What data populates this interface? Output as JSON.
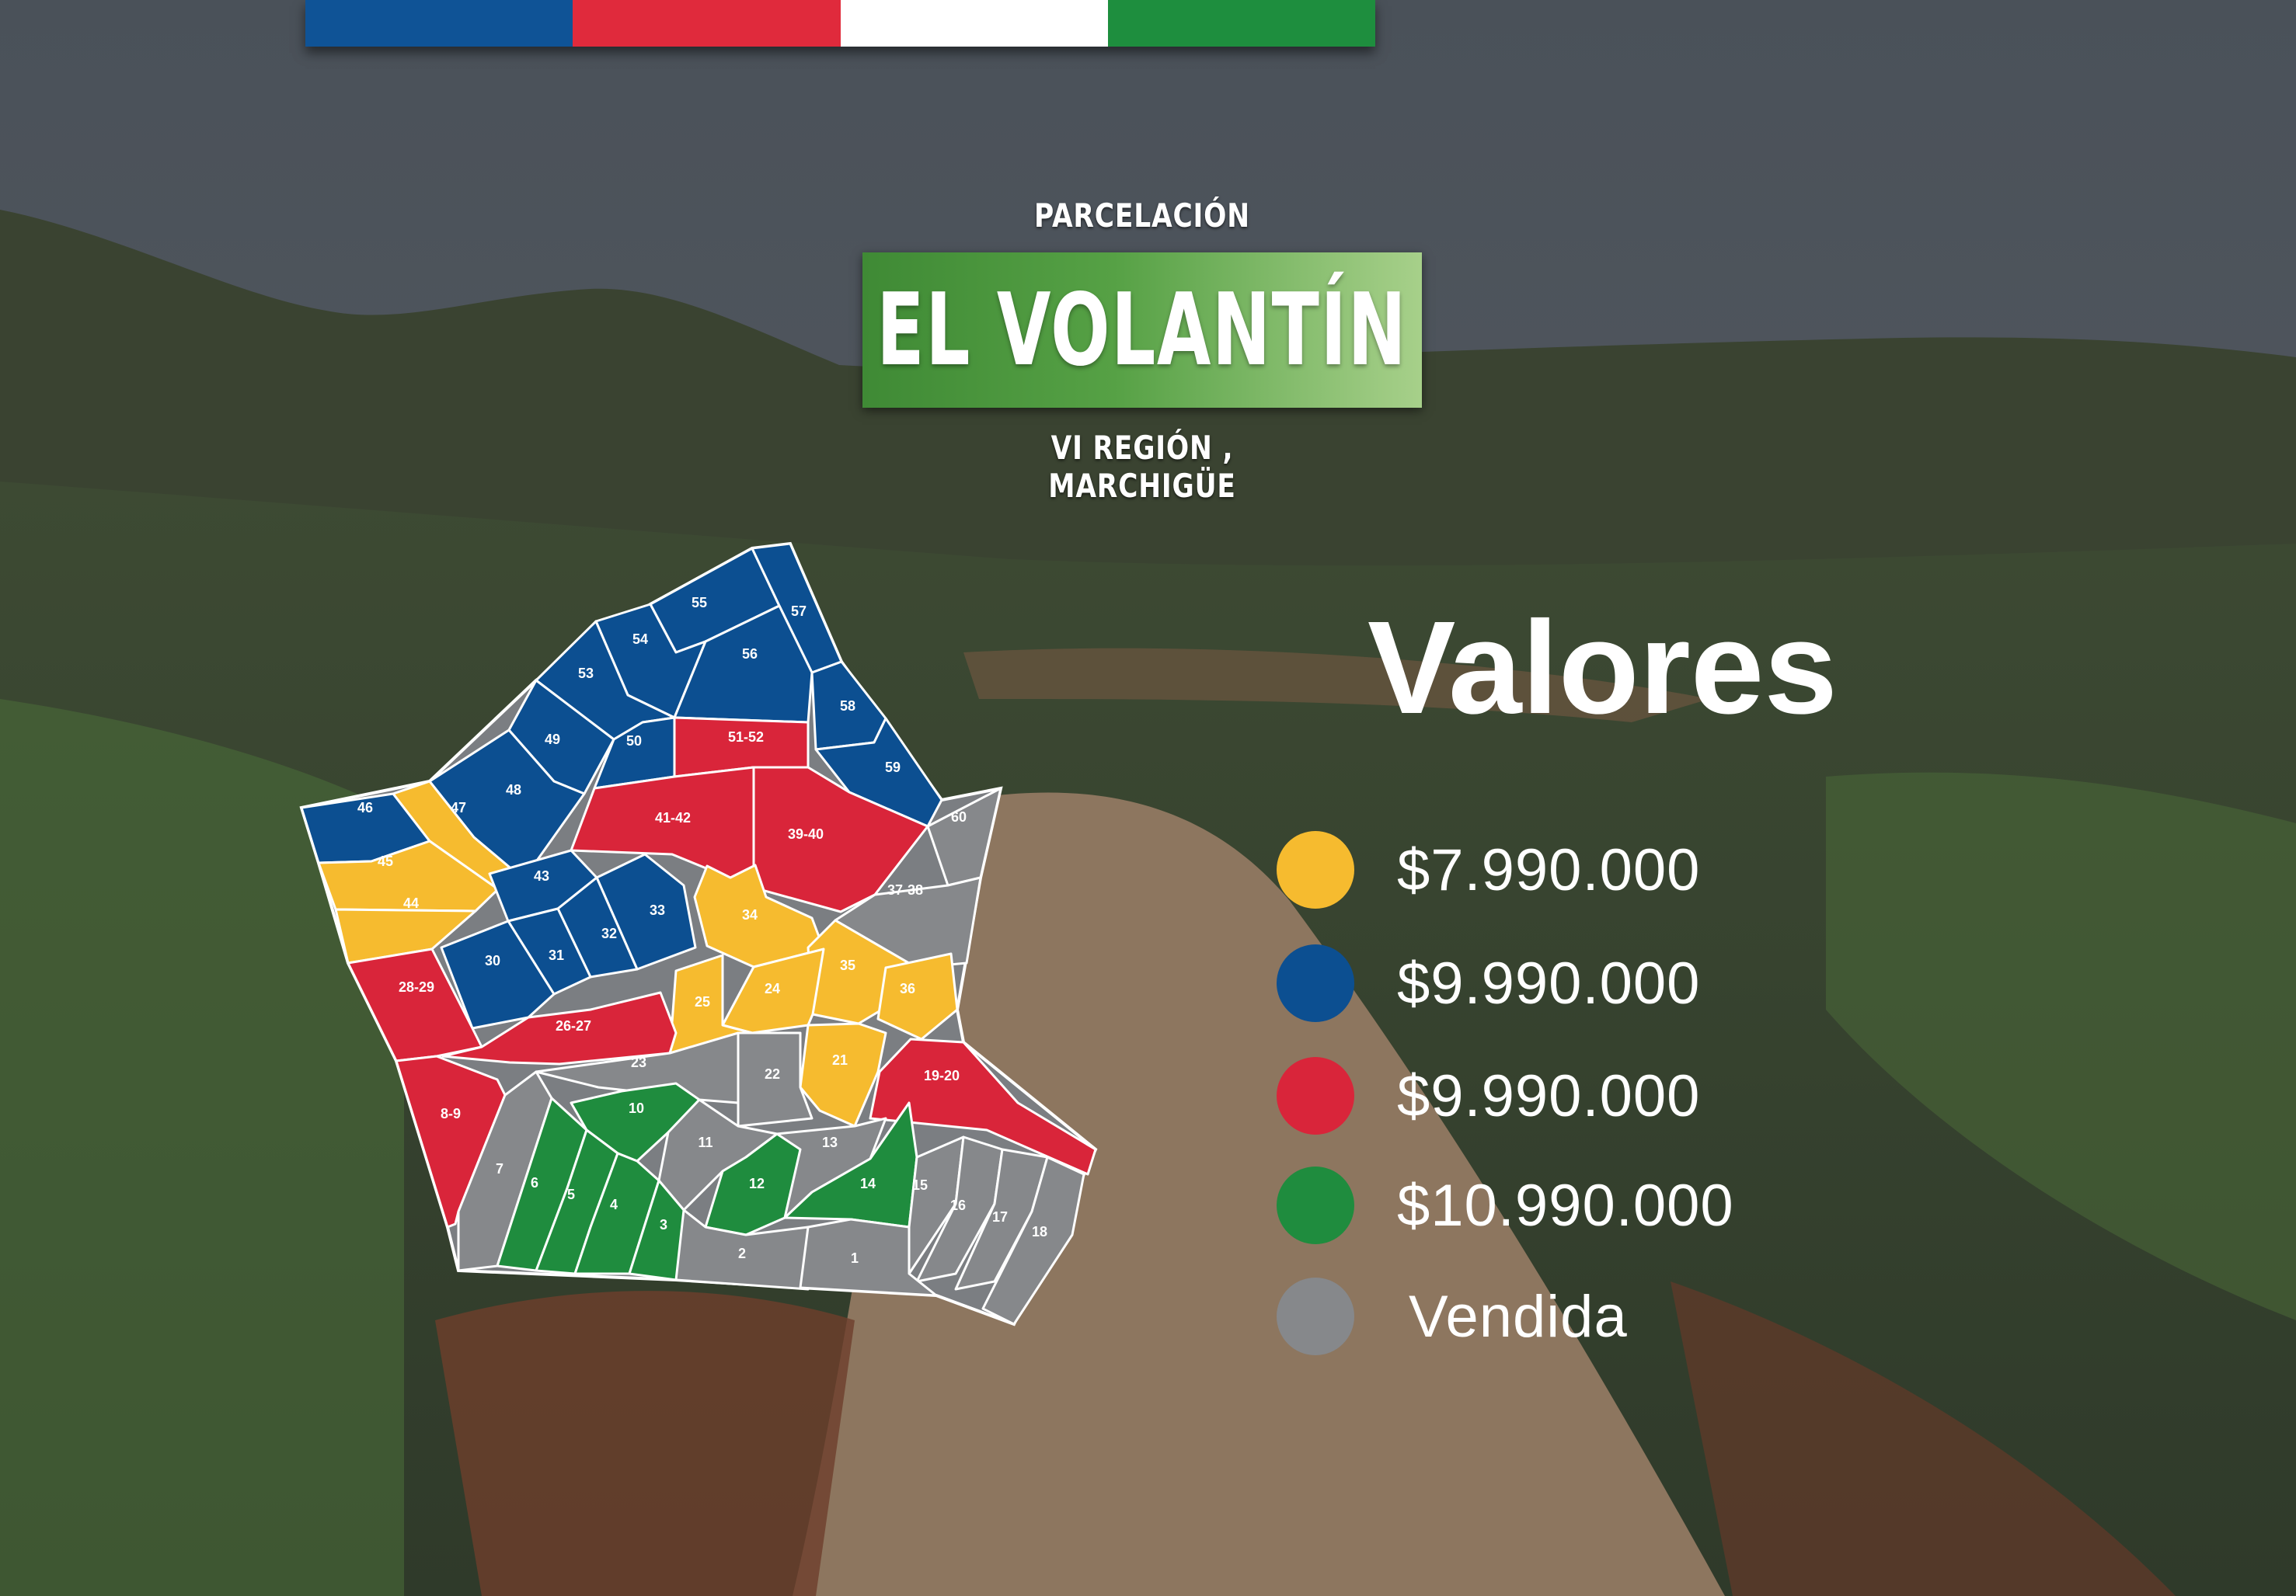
{
  "header": {
    "top_label": "PARCELACIÓN",
    "title": "EL VOLANTÍN",
    "region": "VI REGIÓN , MARCHIGÜE"
  },
  "flag_colors": [
    "#0f5396",
    "#e02a3c",
    "#ffffff",
    "#1e8e3e"
  ],
  "legend": {
    "title": "Valores",
    "items": [
      {
        "color": "#f6bb2f",
        "label": "$7.990.000"
      },
      {
        "color": "#0c4f91",
        "label": "$9.990.000"
      },
      {
        "color": "#d9253a",
        "label": "$9.990.000"
      },
      {
        "color": "#1f8c3e",
        "label": "$10.990.000"
      },
      {
        "color": "#86888b",
        "label": "Vendida"
      }
    ]
  },
  "lot_colors": {
    "yellow": "#f6bb2f",
    "blue": "#0c4f91",
    "red": "#d9253a",
    "green": "#1f8c3e",
    "gray": "#86888b"
  },
  "lots": [
    {
      "label": "55",
      "status": "blue"
    },
    {
      "label": "57",
      "status": "blue"
    },
    {
      "label": "54",
      "status": "blue"
    },
    {
      "label": "56",
      "status": "blue"
    },
    {
      "label": "53",
      "status": "blue"
    },
    {
      "label": "58",
      "status": "blue"
    },
    {
      "label": "49",
      "status": "blue"
    },
    {
      "label": "50",
      "status": "blue"
    },
    {
      "label": "51-52",
      "status": "red"
    },
    {
      "label": "59",
      "status": "blue"
    },
    {
      "label": "46",
      "status": "blue"
    },
    {
      "label": "47",
      "status": "yellow"
    },
    {
      "label": "48",
      "status": "blue"
    },
    {
      "label": "41-42",
      "status": "red"
    },
    {
      "label": "39-40",
      "status": "red"
    },
    {
      "label": "60",
      "status": "gray"
    },
    {
      "label": "45",
      "status": "yellow"
    },
    {
      "label": "43",
      "status": "blue"
    },
    {
      "label": "37-38",
      "status": "gray"
    },
    {
      "label": "44",
      "status": "yellow"
    },
    {
      "label": "33",
      "status": "blue"
    },
    {
      "label": "34",
      "status": "yellow"
    },
    {
      "label": "32",
      "status": "blue"
    },
    {
      "label": "31",
      "status": "blue"
    },
    {
      "label": "30",
      "status": "blue"
    },
    {
      "label": "35",
      "status": "yellow"
    },
    {
      "label": "28-29",
      "status": "red"
    },
    {
      "label": "24",
      "status": "yellow"
    },
    {
      "label": "36",
      "status": "yellow"
    },
    {
      "label": "25",
      "status": "yellow"
    },
    {
      "label": "26-27",
      "status": "red"
    },
    {
      "label": "21",
      "status": "yellow"
    },
    {
      "label": "23",
      "status": "gray"
    },
    {
      "label": "22",
      "status": "gray"
    },
    {
      "label": "19-20",
      "status": "red"
    },
    {
      "label": "8-9",
      "status": "red"
    },
    {
      "label": "10",
      "status": "green"
    },
    {
      "label": "11",
      "status": "gray"
    },
    {
      "label": "13",
      "status": "gray"
    },
    {
      "label": "7",
      "status": "gray"
    },
    {
      "label": "6",
      "status": "green"
    },
    {
      "label": "12",
      "status": "green"
    },
    {
      "label": "14",
      "status": "green"
    },
    {
      "label": "15",
      "status": "gray"
    },
    {
      "label": "5",
      "status": "green"
    },
    {
      "label": "4",
      "status": "green"
    },
    {
      "label": "16",
      "status": "gray"
    },
    {
      "label": "17",
      "status": "gray"
    },
    {
      "label": "3",
      "status": "green"
    },
    {
      "label": "18",
      "status": "gray"
    },
    {
      "label": "2",
      "status": "gray"
    },
    {
      "label": "1",
      "status": "gray"
    }
  ]
}
